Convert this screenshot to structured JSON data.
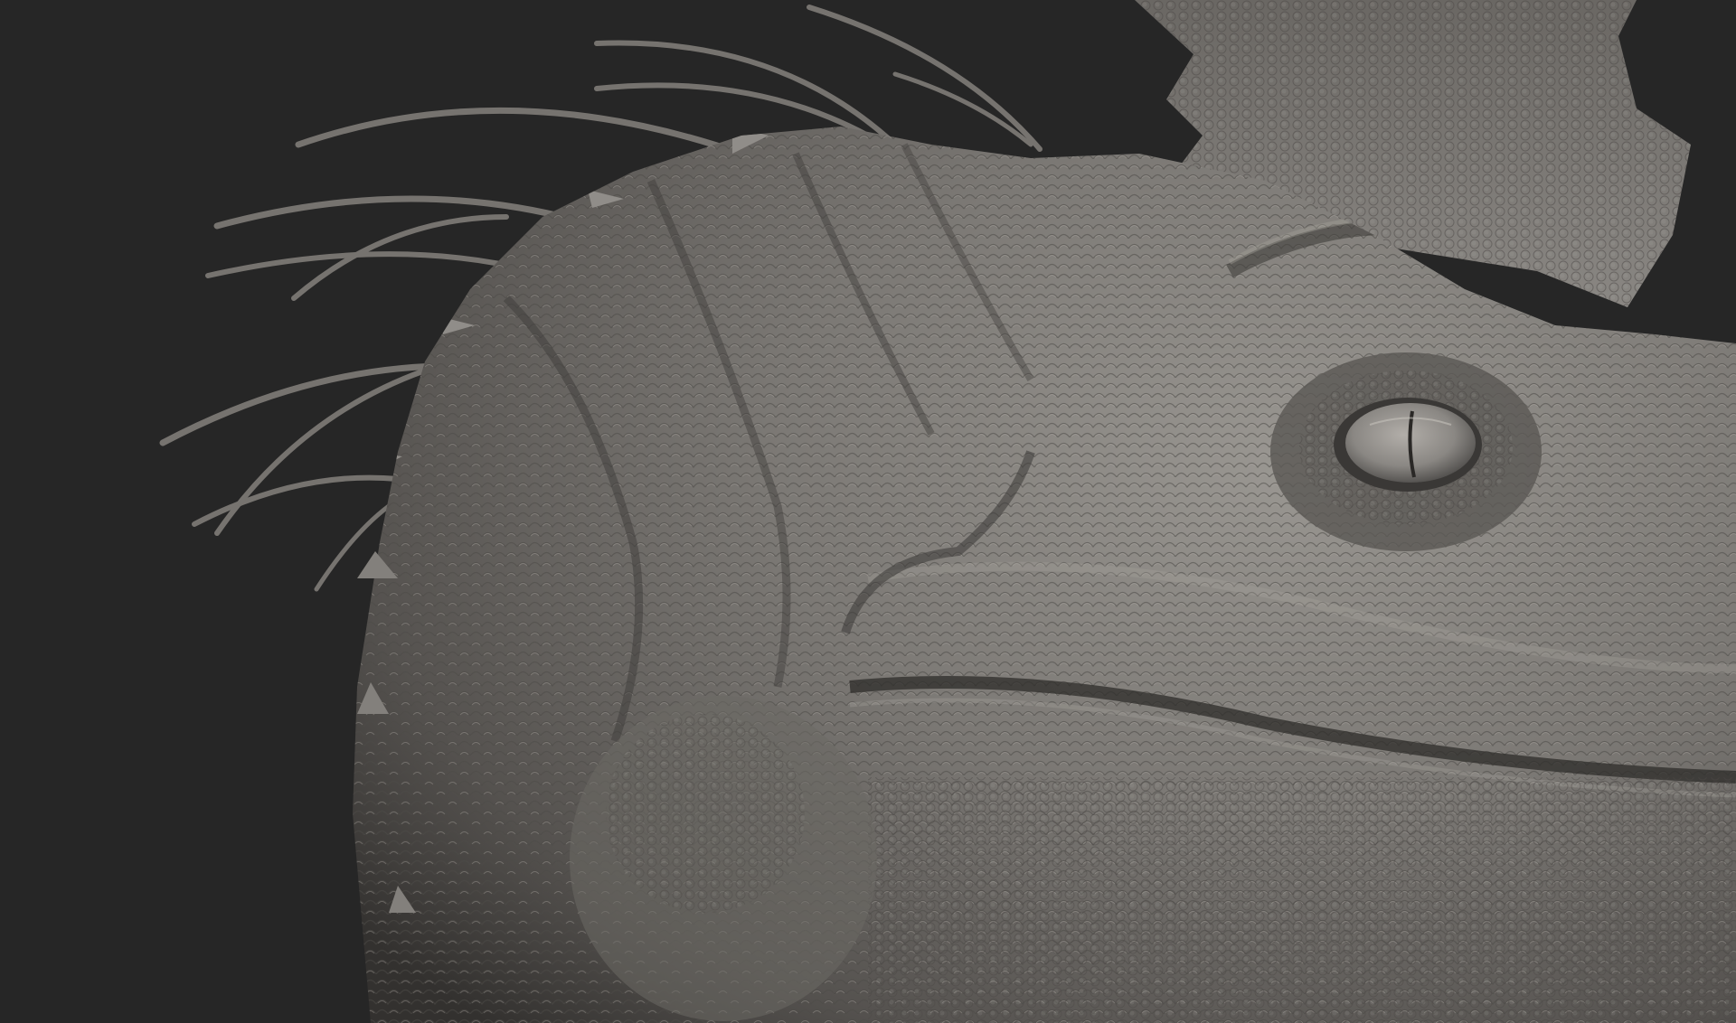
{
  "scene": {
    "subject": "sculpted-creature-head",
    "background_color": "#262626",
    "material_color": "#7d7a76",
    "material_highlight": "#c4c0ba",
    "material_shadow": "#2f2d2b",
    "eye_color": "#8d8a86"
  }
}
